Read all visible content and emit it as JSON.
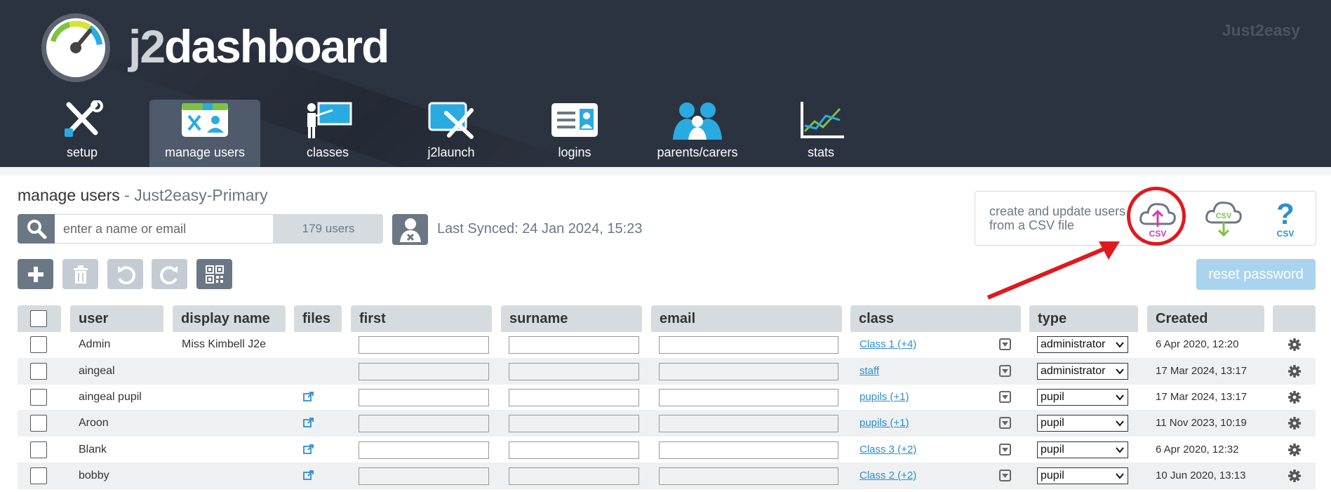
{
  "header": {
    "logo_j2": "j2",
    "logo_rest": "dashboard",
    "brand": "Just2easy"
  },
  "nav": [
    {
      "label": "setup",
      "icon": "tools-icon"
    },
    {
      "label": "manage users",
      "icon": "manage-users-icon",
      "active": true
    },
    {
      "label": "classes",
      "icon": "classes-icon"
    },
    {
      "label": "j2launch",
      "icon": "j2launch-icon"
    },
    {
      "label": "logins",
      "icon": "logins-icon"
    },
    {
      "label": "parents/carers",
      "icon": "parents-icon"
    },
    {
      "label": "stats",
      "icon": "stats-icon"
    }
  ],
  "page": {
    "title": "manage users",
    "separator": " - ",
    "school": "Just2easy-Primary"
  },
  "search": {
    "placeholder": "enter a name or email",
    "count": "179 users"
  },
  "sync": {
    "text": "Last Synced: 24 Jan 2024, 15:23"
  },
  "csv": {
    "text": "create and update users from a CSV file",
    "upload_label": "CSV",
    "download_label": "CSV",
    "help_label": "CSV"
  },
  "toolbar": {
    "reset_label": "reset password"
  },
  "table": {
    "columns": [
      "user",
      "display name",
      "files",
      "first",
      "surname",
      "email",
      "class",
      "type",
      "Created"
    ],
    "rows": [
      {
        "user": "Admin",
        "display": "Miss Kimbell J2e",
        "files": false,
        "class": "Class 1 (+4)",
        "type": "administrator",
        "created": "6 Apr 2020, 12:20"
      },
      {
        "user": "aingeal",
        "display": "",
        "files": false,
        "class": "staff",
        "type": "administrator",
        "created": "17 Mar 2024, 13:17"
      },
      {
        "user": "aingeal pupil",
        "display": "",
        "files": true,
        "class": "pupils (+1)",
        "type": "pupil",
        "created": "17 Mar 2024, 13:17"
      },
      {
        "user": "Aroon",
        "display": "",
        "files": true,
        "class": "pupils (+1)",
        "type": "pupil",
        "created": "11 Nov 2023, 10:19"
      },
      {
        "user": "Blank",
        "display": "",
        "files": true,
        "class": "Class 3 (+2)",
        "type": "pupil",
        "created": "6 Apr 2020, 12:32"
      },
      {
        "user": "bobby",
        "display": "",
        "files": true,
        "class": "Class 2 (+2)",
        "type": "pupil",
        "created": "10 Jun 2020, 13:13"
      }
    ]
  },
  "colors": {
    "header_bg": "#2c3340",
    "accent": "#2b8fd0",
    "highlight": "#e0191e"
  }
}
